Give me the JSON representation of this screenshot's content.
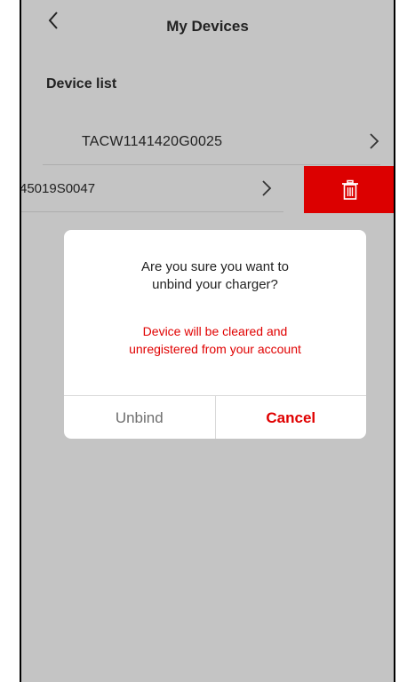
{
  "header": {
    "title": "My Devices",
    "back_icon": "chevron-left-icon"
  },
  "device_list": {
    "title": "Device list",
    "items": [
      {
        "serial": "TACW1141420G0025"
      },
      {
        "serial": "45019S0047"
      }
    ],
    "delete_icon": "trash-icon",
    "delete_color": "#dc0000"
  },
  "dialog": {
    "title_line1": "Are you sure you want to",
    "title_line2": "unbind your charger?",
    "message_line1": "Device will be cleared and",
    "message_line2": "unregistered from your account",
    "unbind_label": "Unbind",
    "cancel_label": "Cancel",
    "accent_color": "#e00000"
  }
}
